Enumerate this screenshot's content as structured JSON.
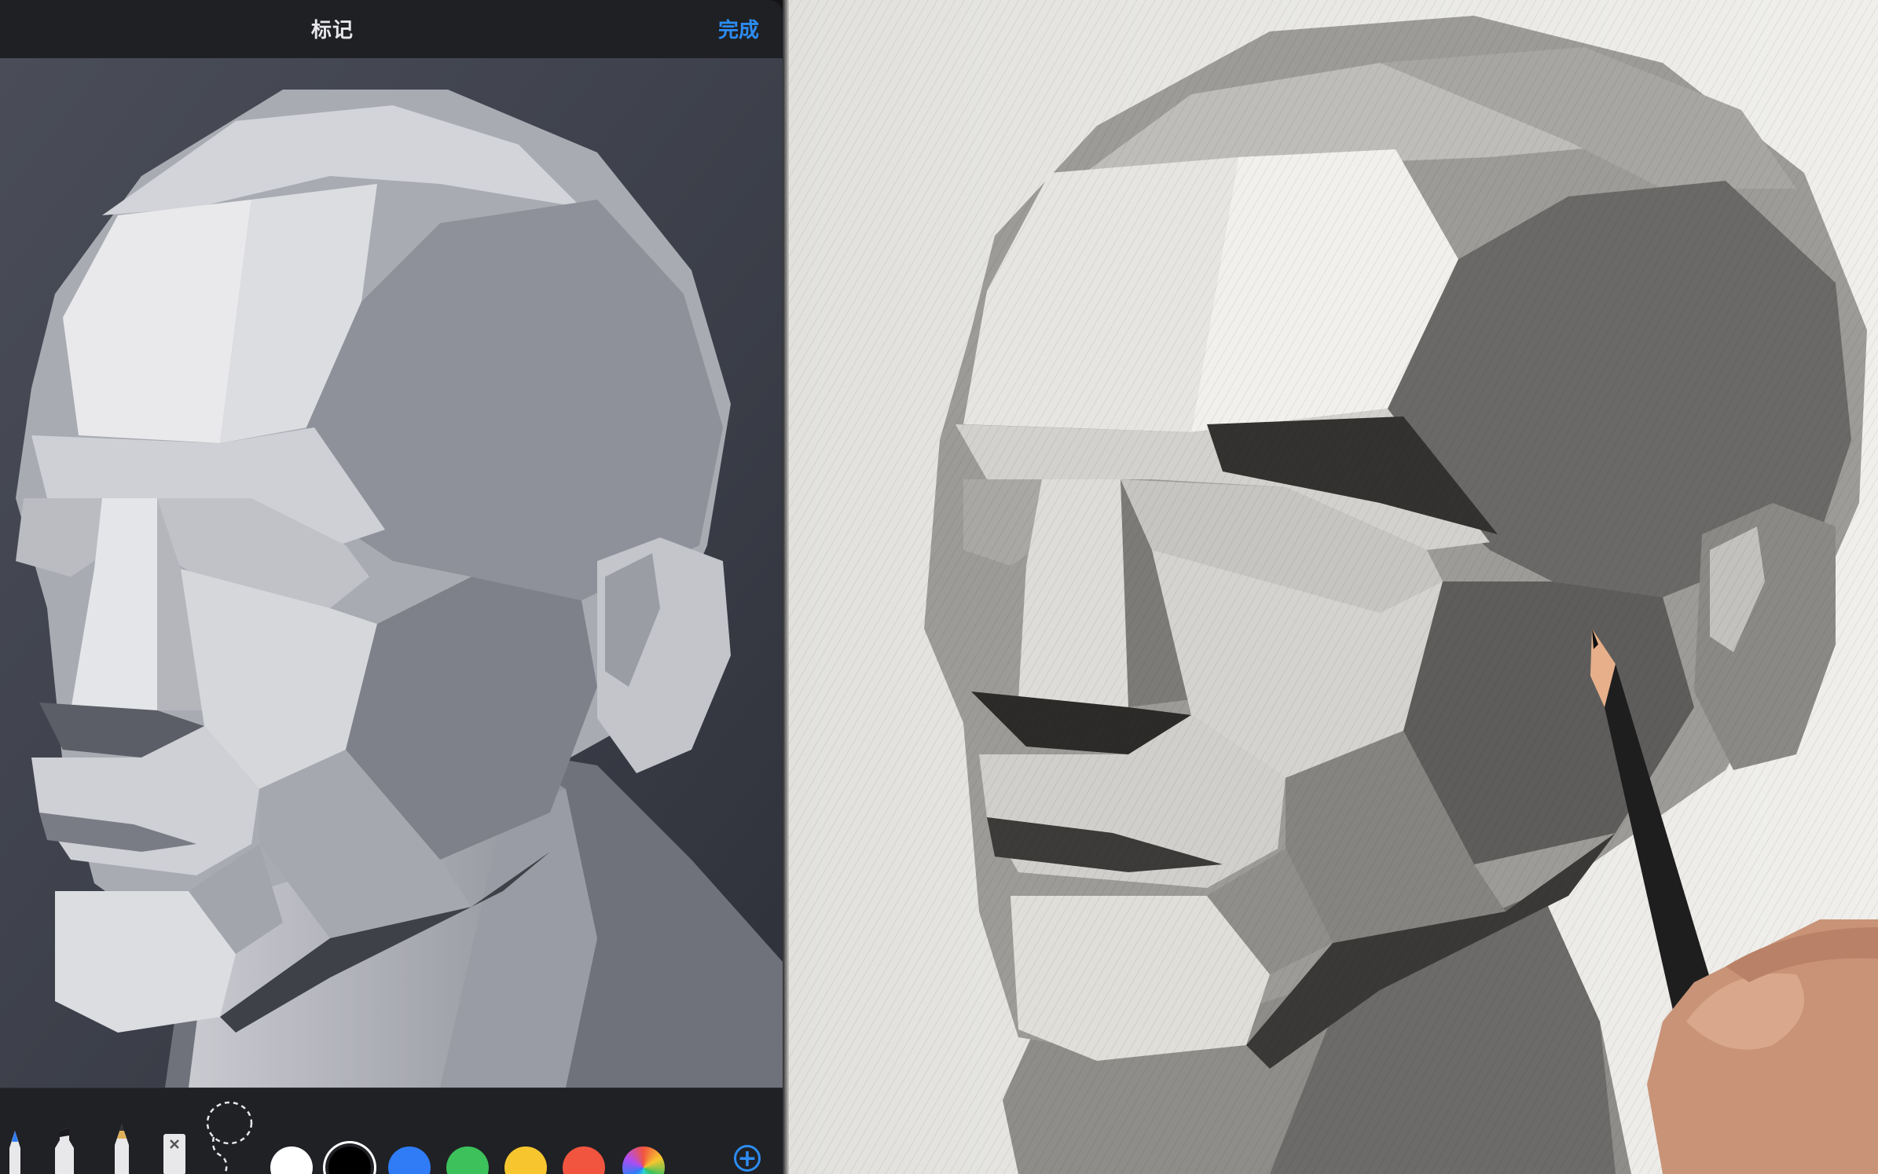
{
  "header": {
    "title": "标记",
    "done_label": "完成"
  },
  "toolbar": {
    "tools": [
      "pen-icon",
      "marker-icon",
      "pencil-icon",
      "eraser-icon",
      "lasso-icon"
    ],
    "selected_color": "#000000",
    "colors": [
      "#ffffff",
      "#000000",
      "#2f7cf6",
      "#3cc15b",
      "#f7c62f",
      "#f2553f",
      "color-wheel"
    ],
    "add_label": "+"
  },
  "colors": {
    "accent": "#2d8cf2",
    "panel_bg": "#1f2023",
    "paper": "#eceae6"
  }
}
